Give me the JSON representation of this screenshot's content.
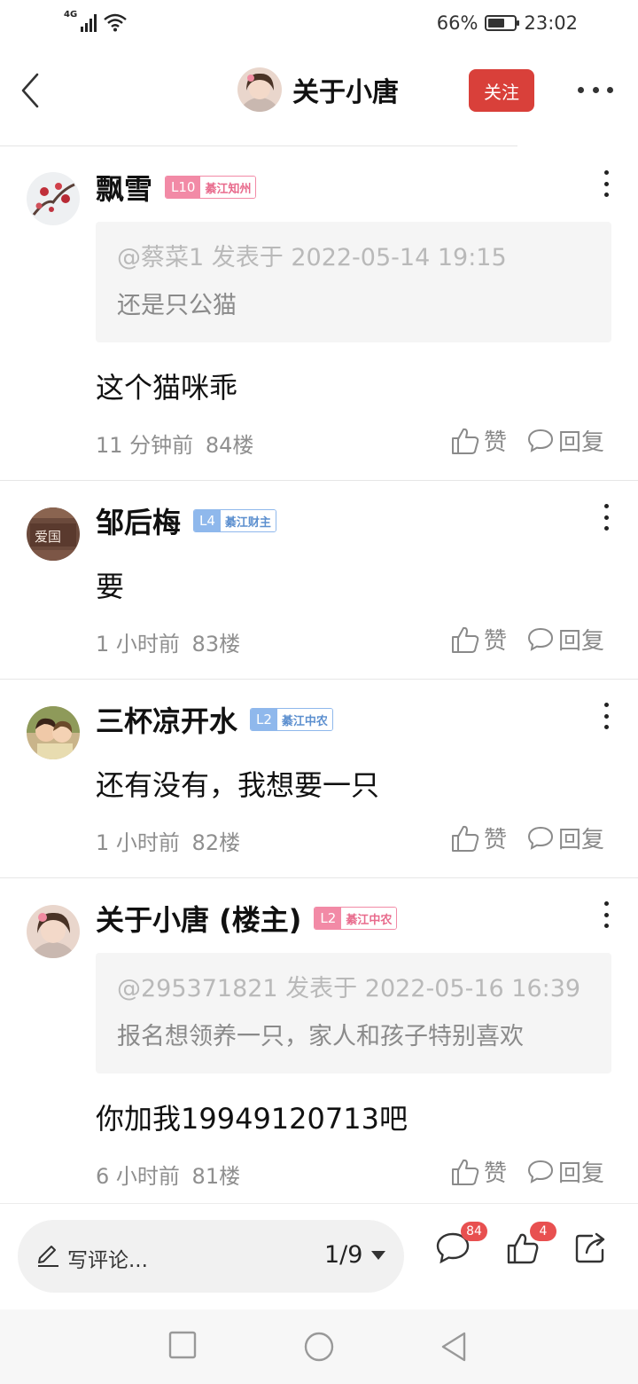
{
  "status_bar": {
    "network": "4G",
    "battery": "66%",
    "battery_level": 0.66,
    "time": "23:02"
  },
  "header": {
    "title": "关于小唐",
    "follow_label": "关注"
  },
  "comments": [
    {
      "username": "飘雪",
      "level": "L10",
      "rank": "綦江知州",
      "badge_color": "#f28aa6",
      "quote": {
        "head": "@蔡菜1 发表于 2022-05-14 19:15",
        "body": "还是只公猫"
      },
      "text": "这个猫咪乖",
      "time": "11 分钟前",
      "floor": "84楼",
      "like_label": "赞",
      "reply_label": "回复"
    },
    {
      "username": "邹后梅",
      "level": "L4",
      "rank": "綦江财主",
      "badge_color": "#8fb8ec",
      "text": "要",
      "time": "1 小时前",
      "floor": "83楼",
      "like_label": "赞",
      "reply_label": "回复"
    },
    {
      "username": "三杯凉开水",
      "level": "L2",
      "rank": "綦江中农",
      "badge_color": "#8fb8ec",
      "text": "还有没有，我想要一只",
      "time": "1 小时前",
      "floor": "82楼",
      "like_label": "赞",
      "reply_label": "回复"
    },
    {
      "username": "关于小唐 (楼主)",
      "level": "L2",
      "rank": "綦江中农",
      "badge_color": "#f28aa6",
      "quote": {
        "head": "@295371821 发表于 2022-05-16 16:39",
        "body": "报名想领养一只，家人和孩子特别喜欢"
      },
      "text": "你加我19949120713吧",
      "time": "6 小时前",
      "floor": "81楼",
      "like_label": "赞",
      "reply_label": "回复"
    }
  ],
  "bottom_bar": {
    "write_placeholder": "写评论...",
    "page_indicator": "1/9",
    "comment_count": "84",
    "like_count": "4"
  },
  "icons": {
    "back": "chevron-left-icon",
    "more": "more-horizontal-icon",
    "kebab": "more-vertical-icon",
    "like": "thumbs-up-icon",
    "reply": "speech-bubble-icon",
    "write": "pencil-icon",
    "share": "share-icon",
    "accent": "#d9403a"
  }
}
